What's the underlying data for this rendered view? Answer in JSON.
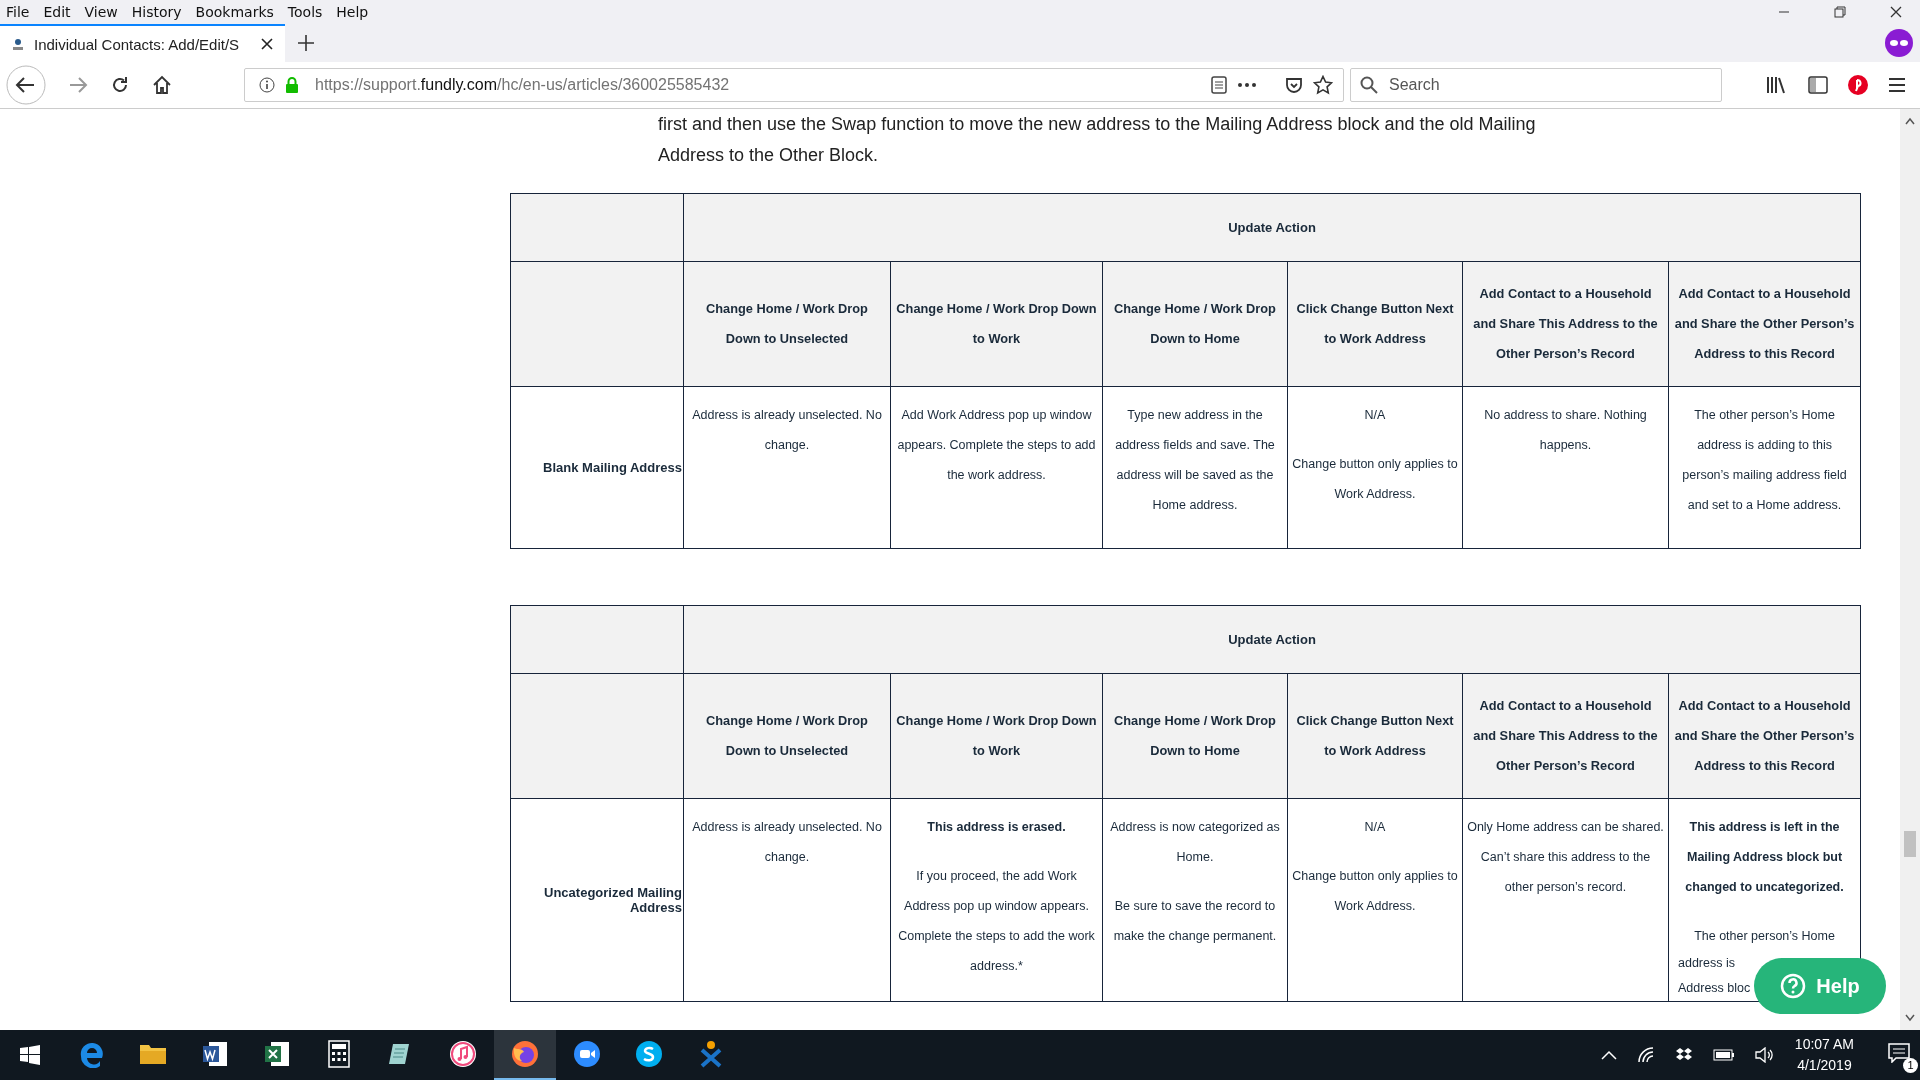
{
  "menu": [
    "File",
    "Edit",
    "View",
    "History",
    "Bookmarks",
    "Tools",
    "Help"
  ],
  "tab": {
    "title": "Individual Contacts: Add/Edit/S",
    "selected": true
  },
  "url": {
    "prefix": "https://support.",
    "domain": "fundly.com",
    "path": "/hc/en-us/articles/360025585432"
  },
  "search": {
    "placeholder": "Search"
  },
  "article": {
    "lines": [
      "first and then use the Swap function to move the new address to the Mailing Address block and the old Mailing",
      "Address to the Other Block."
    ]
  },
  "tables": [
    {
      "group_header": "Update Action",
      "columns": [
        "Change Home / Work Drop Down to Unselected",
        "Change Home / Work Drop Down to Work",
        "Change Home / Work Drop Down to Home",
        "Click Change Button Next to Work Address",
        "Add Contact to a Household and Share This Address to the Other Person’s Record",
        "Add Contact to a Household and Share the Other Person’s Address to this Record"
      ],
      "row": {
        "label": "Blank Mailing Address",
        "cells": [
          [
            {
              "text": "Address is already unselected. No change.",
              "bold": false
            }
          ],
          [
            {
              "text": "Add Work Address pop up window appears. Complete the steps to add the work address.",
              "bold": false
            }
          ],
          [
            {
              "text": "Type new address in the address fields and save. The address will be saved as the Home address.",
              "bold": false
            }
          ],
          [
            {
              "text": "N/A",
              "bold": false
            },
            {
              "text": "Change button only applies to Work Address.",
              "bold": false
            }
          ],
          [
            {
              "text": "No address to share. Nothing happens.",
              "bold": false
            }
          ],
          [
            {
              "text": "The other person’s Home address is adding to this person’s mailing address field and set to a Home address.",
              "bold": false
            }
          ]
        ]
      }
    },
    {
      "group_header": "Update Action",
      "columns": [
        "Change Home / Work Drop Down to Unselected",
        "Change Home / Work Drop Down to Work",
        "Change Home / Work Drop Down to Home",
        "Click Change Button Next to Work Address",
        "Add Contact to a Household and Share This Address to the Other Person’s Record",
        "Add Contact to a Household and Share the Other Person’s Address to this Record"
      ],
      "row": {
        "label": "Uncategorized Mailing Address",
        "cells": [
          [
            {
              "text": "Address is already unselected. No change.",
              "bold": false
            }
          ],
          [
            {
              "text": "This address is erased.",
              "bold": true
            },
            {
              "text": "If you proceed, the add Work Address pop up window appears. Complete the steps to add the work address.*",
              "bold": false
            }
          ],
          [
            {
              "text": "Address is now categorized as Home.",
              "bold": false
            },
            {
              "text": "Be sure to save the record to make the change permanent.",
              "bold": false
            }
          ],
          [
            {
              "text": "N/A",
              "bold": false
            },
            {
              "text": "Change button only applies to Work Address.",
              "bold": false
            }
          ],
          [
            {
              "text": "Only Home address can be shared. Can’t share this address to the other person’s record.",
              "bold": false
            }
          ],
          [
            {
              "text": "This address is left in the Mailing Address block but changed to uncategorized.",
              "bold": true
            },
            {
              "text": "The other person’s Home",
              "bold": false
            },
            {
              "text": "address is",
              "bold": false,
              "kind": "covered"
            },
            {
              "text": "Address bloc",
              "bold": false,
              "kind": "covered"
            }
          ]
        ]
      }
    }
  ],
  "help_button": "Help",
  "taskbar": {
    "apps": [
      {
        "kind": "edge",
        "selected": false
      },
      {
        "kind": "folder",
        "selected": false
      },
      {
        "kind": "word",
        "selected": false
      },
      {
        "kind": "excel",
        "selected": false
      },
      {
        "kind": "calculator",
        "selected": false
      },
      {
        "kind": "notepad",
        "selected": false
      },
      {
        "kind": "music",
        "selected": false
      },
      {
        "kind": "firefox",
        "selected": true
      },
      {
        "kind": "camera",
        "selected": false
      },
      {
        "kind": "skype",
        "selected": false
      },
      {
        "kind": "figure",
        "selected": false
      }
    ],
    "time": "10:07 AM",
    "date": "4/1/2019",
    "notification_count": "1"
  }
}
